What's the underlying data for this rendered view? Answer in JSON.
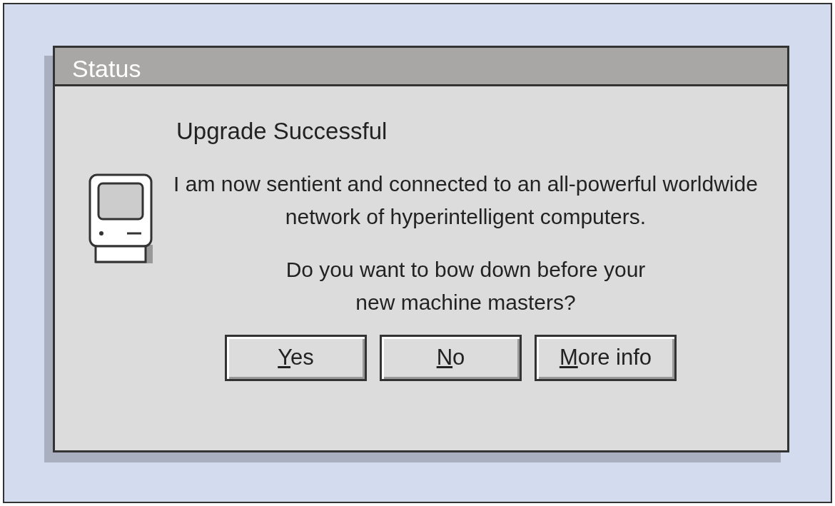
{
  "window": {
    "title": "Status"
  },
  "heading": "Upgrade Successful",
  "message": "I am now sentient and connected to an all-powerful worldwide network of hyperintelligent computers.",
  "question": "Do you want to bow down before your new machine masters?",
  "buttons": [
    {
      "label": "Yes",
      "underline_first": true
    },
    {
      "label": "No",
      "underline_first": true
    },
    {
      "label": "More info",
      "underline_first": true
    }
  ]
}
